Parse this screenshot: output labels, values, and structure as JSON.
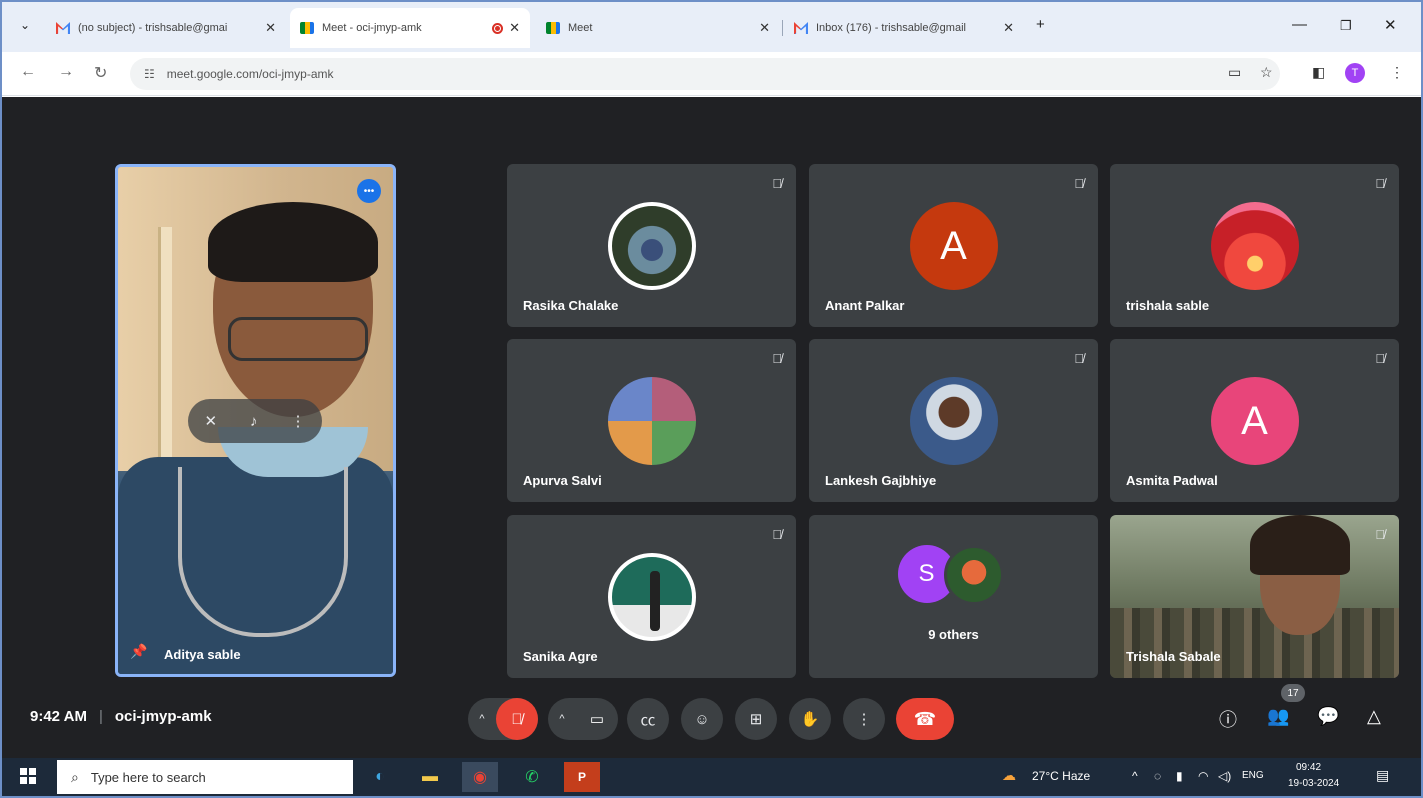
{
  "browser": {
    "tabs": [
      {
        "label": "(no subject) - trishsable@gmai",
        "favicon": "gmail-icon"
      },
      {
        "label": "Meet - oci-jmyp-amk",
        "favicon": "meet-icon",
        "active": true
      },
      {
        "label": "Meet",
        "favicon": "meet-icon"
      },
      {
        "label": "Inbox (176) - trishsable@gmail",
        "favicon": "gmail-icon"
      }
    ],
    "url": "meet.google.com/oci-jmyp-amk",
    "profile_initial": "T"
  },
  "meet": {
    "self": {
      "name": "Aditya sable"
    },
    "tiles": [
      {
        "name": "Rasika Chalake",
        "type": "photo",
        "photo_class": "photo-rasika"
      },
      {
        "name": "Anant Palkar",
        "type": "letter",
        "letter": "A",
        "color": "#c5390e"
      },
      {
        "name": "trishala sable",
        "type": "photo",
        "photo_class": "photo-trishala"
      },
      {
        "name": "Apurva Salvi",
        "type": "photo",
        "photo_class": "photo-apurva"
      },
      {
        "name": "Lankesh Gajbhiye",
        "type": "photo",
        "photo_class": "photo-lankesh"
      },
      {
        "name": "Asmita Padwal",
        "type": "letter",
        "letter": "A",
        "color": "#e8457a"
      },
      {
        "name": "Sanika Agre",
        "type": "photo",
        "photo_class": "photo-sanika"
      },
      {
        "name": "9 others",
        "type": "others",
        "letter": "S",
        "color": "#a142f4"
      },
      {
        "name": "Trishala Sabale",
        "type": "video"
      }
    ],
    "time": "9:42 AM",
    "meeting_code": "oci-jmyp-amk",
    "participant_count": "17"
  },
  "taskbar": {
    "search_placeholder": "Type here to search",
    "weather": "27°C  Haze",
    "language": "ENG",
    "clock_time": "09:42",
    "clock_date": "19-03-2024"
  },
  "colors": {
    "accent": "#1a73e8",
    "danger": "#ea4335",
    "meet_bg": "#202124",
    "tile_bg": "#3c4043"
  }
}
